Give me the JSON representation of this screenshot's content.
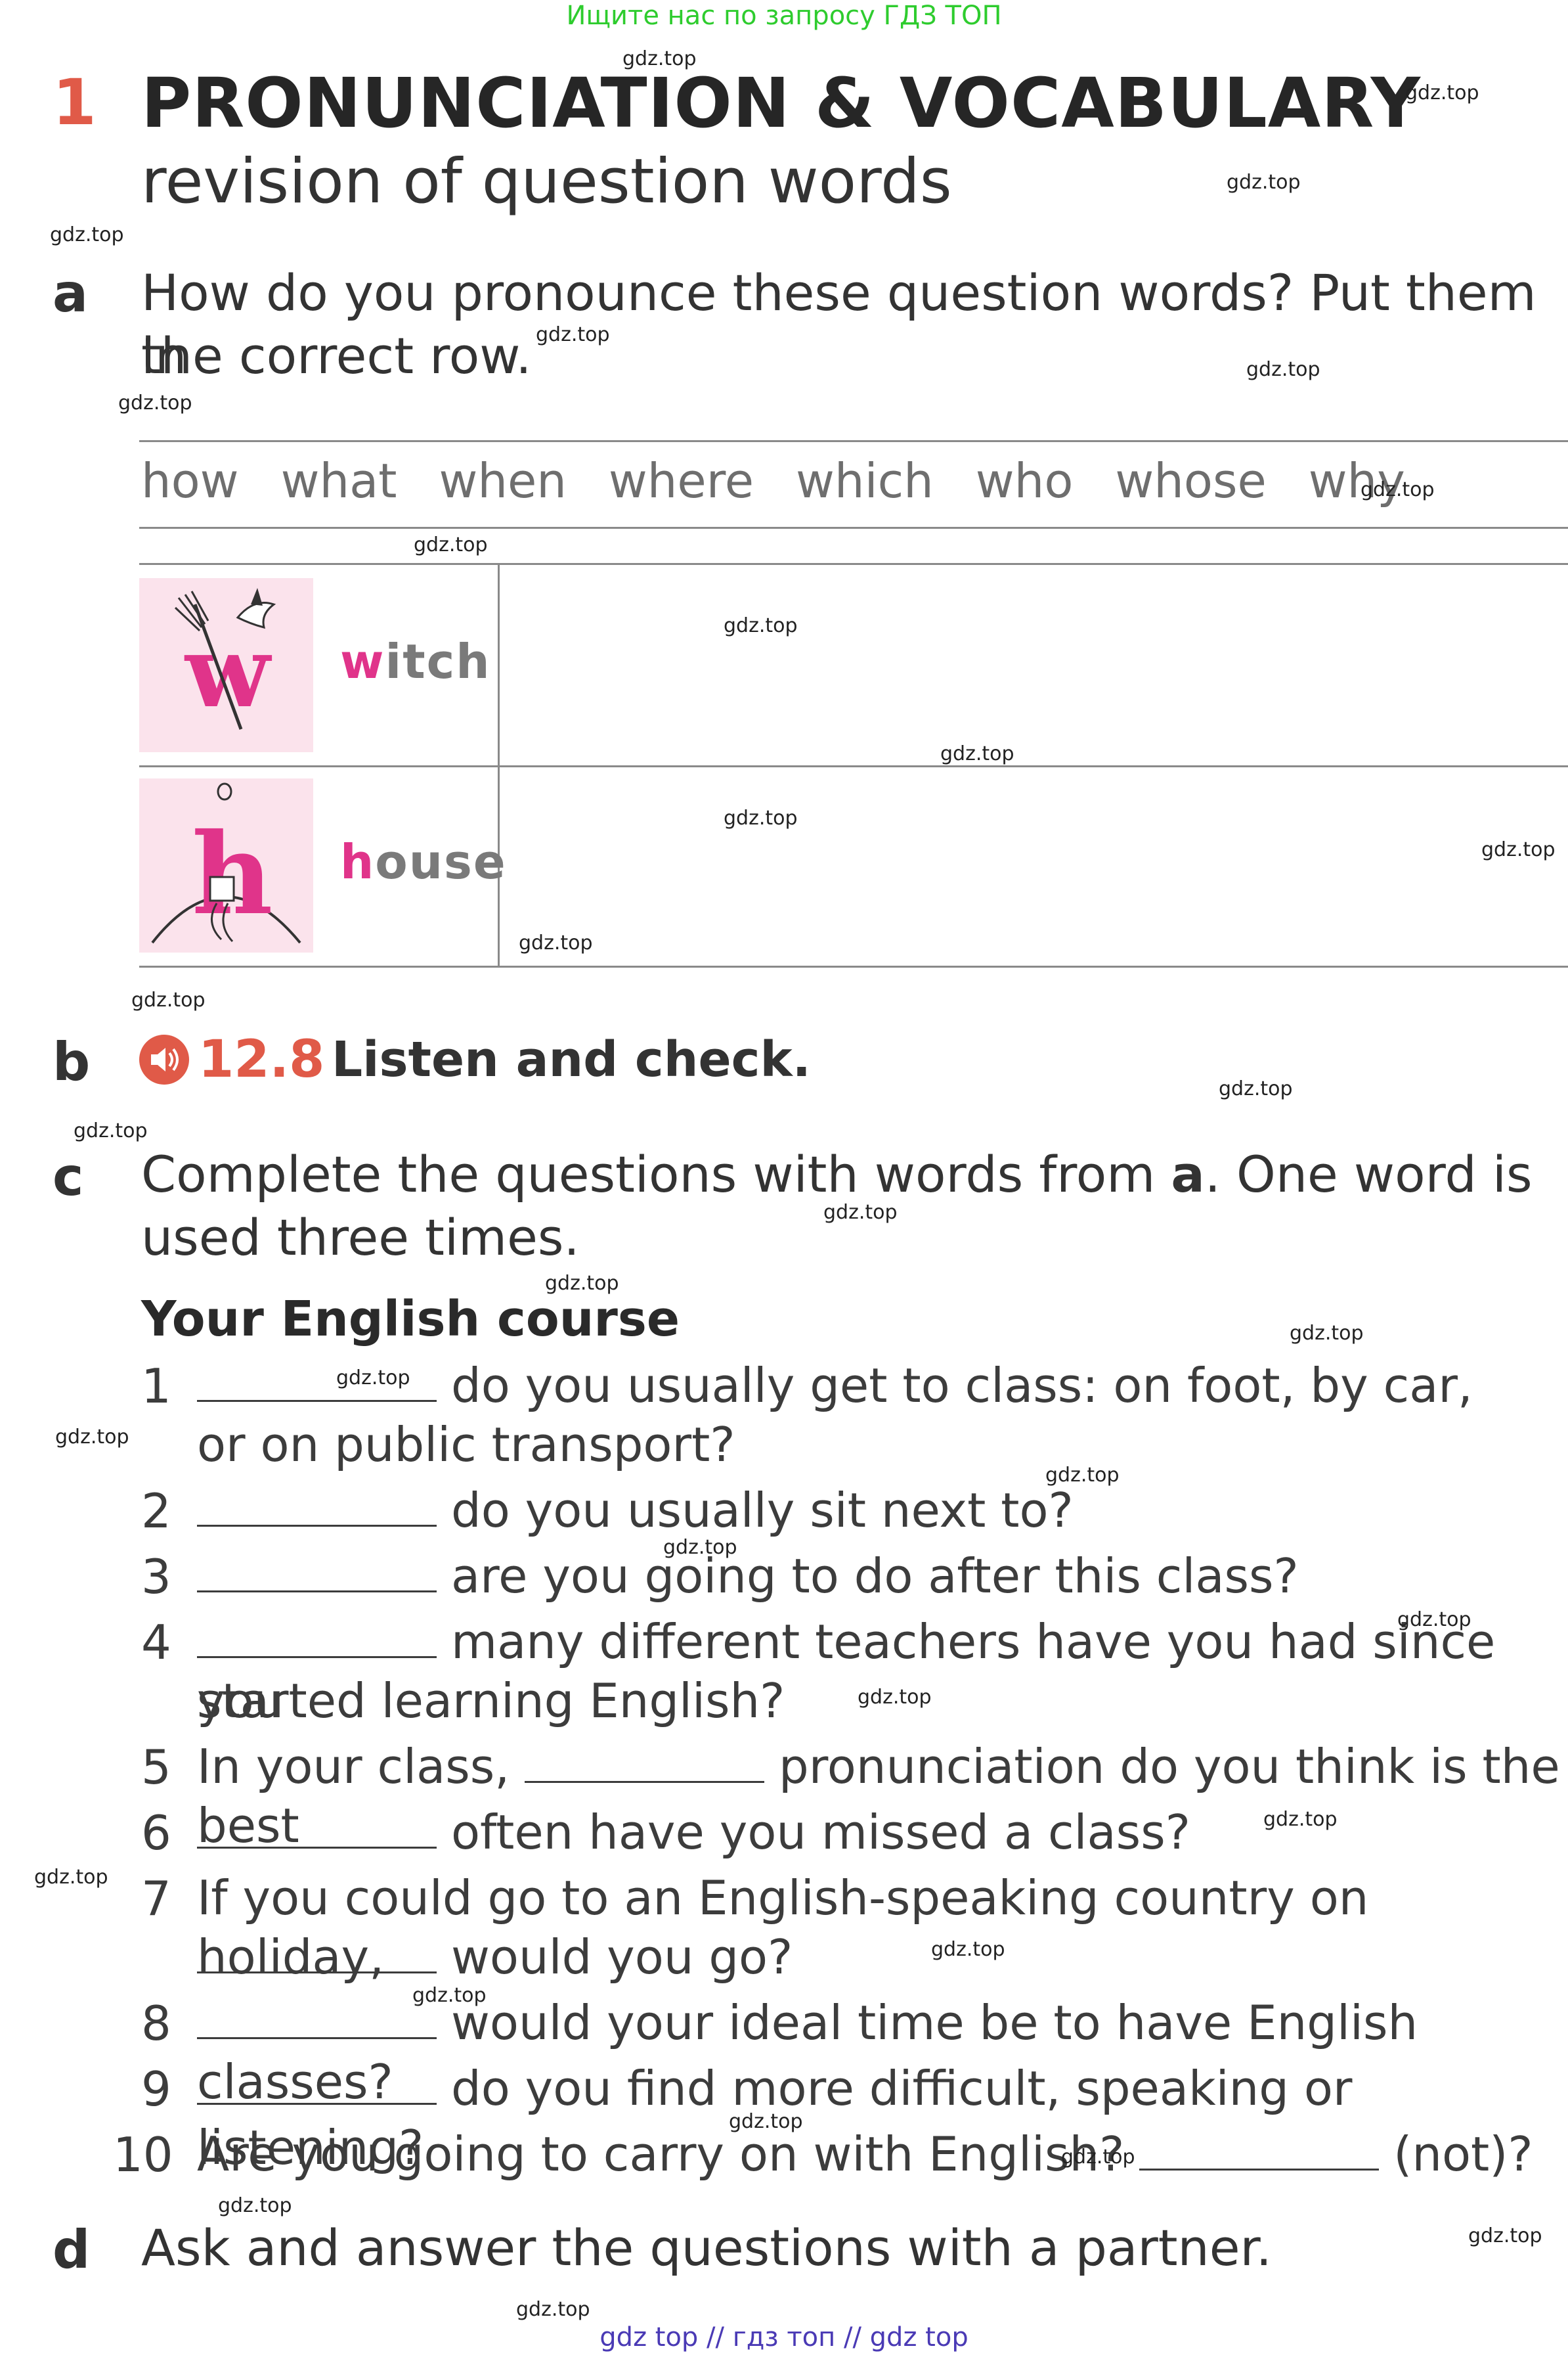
{
  "banner": "Ищите нас по запросу ГДЗ ТОП",
  "footer": "gdz top  //  гдз топ  //  gdz top",
  "watermark": "gdz.top",
  "section": {
    "number": "1",
    "title": "PRONUNCIATION & VOCABULARY",
    "subtitle": "revision of question words"
  },
  "part_a": {
    "letter": "a",
    "line1": "How do you pronounce these question words? Put them in",
    "line2": "the correct row.",
    "words": [
      "how",
      "what",
      "when",
      "where",
      "which",
      "who",
      "whose",
      "why"
    ],
    "rows": [
      {
        "icon": "witch-broom-icon",
        "highlight": "w",
        "rest": "itch"
      },
      {
        "icon": "house-on-hill-icon",
        "highlight": "h",
        "rest": "ouse"
      }
    ]
  },
  "part_b": {
    "letter": "b",
    "audio_code": "12.8",
    "text": "Listen and check."
  },
  "part_c": {
    "letter": "c",
    "line1_pre": "Complete the questions with words from ",
    "line1_bold": "a",
    "line1_post": ". One word is",
    "line2": "used three times.",
    "subheading": "Your English course",
    "q1_a": "do you usually get to class: on foot, by car,",
    "q1_b": "or on public transport?",
    "q2": "do you usually sit next to?",
    "q3": "are you going to do after this class?",
    "q4_a": "many different teachers have you had since you",
    "q4_b": "started learning English?",
    "q5_pre": "In your class,",
    "q5_post": "pronunciation do you think is the best",
    "q6": "often have you missed a class?",
    "q7_a": "If you could go to an English-speaking country on holiday,",
    "q7_b": "would you go?",
    "q8": "would your ideal time be to have English classes?",
    "q9": "do you find more difficult, speaking or listening?",
    "q10_pre": "Are you going to carry on with English?",
    "q10_post": "(not)?",
    "nums": [
      "1",
      "2",
      "3",
      "4",
      "5",
      "6",
      "7",
      "8",
      "9",
      "10"
    ]
  },
  "part_d": {
    "letter": "d",
    "text": "Ask and answer the questions with a partner."
  },
  "colors": {
    "accent": "#e05a48",
    "pink": "#e0348a",
    "banner_green": "#2ecc2e",
    "footer_blue": "#4a3ab5"
  }
}
